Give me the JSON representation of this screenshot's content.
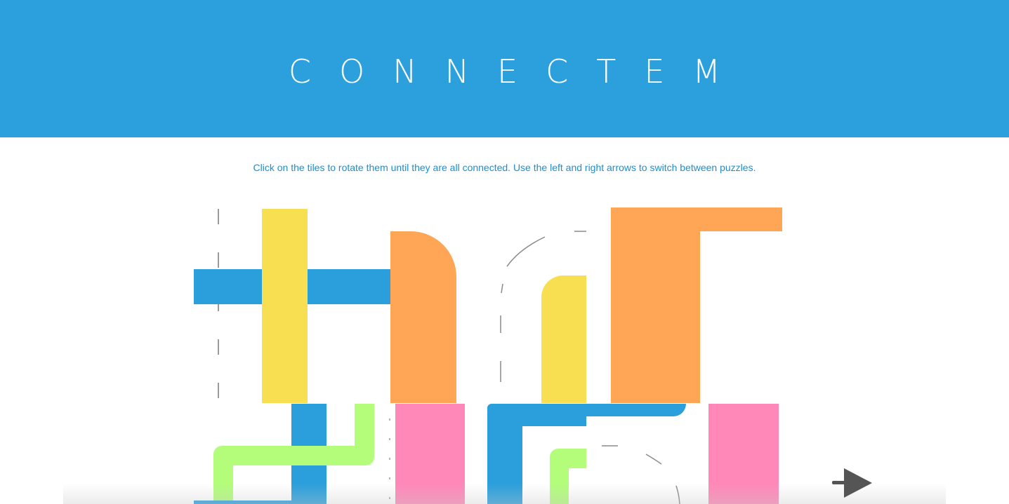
{
  "header": {
    "title": "CONNECTEM"
  },
  "instructions": "Click on the tiles to rotate them until they are all connected. Use the left and right arrows to switch between puzzles.",
  "colors": {
    "header_bg": "#2ba0dc",
    "instructions_text": "#1a8fd0",
    "blue": "#2b9fdc",
    "yellow": "#f8df52",
    "orange": "#ffa556",
    "pink": "#ff88b8",
    "green": "#b3fd7b",
    "ghost_outline": "#8a8a8a",
    "arrow": "#555555"
  },
  "icons": {
    "next": "right-arrow-icon"
  }
}
